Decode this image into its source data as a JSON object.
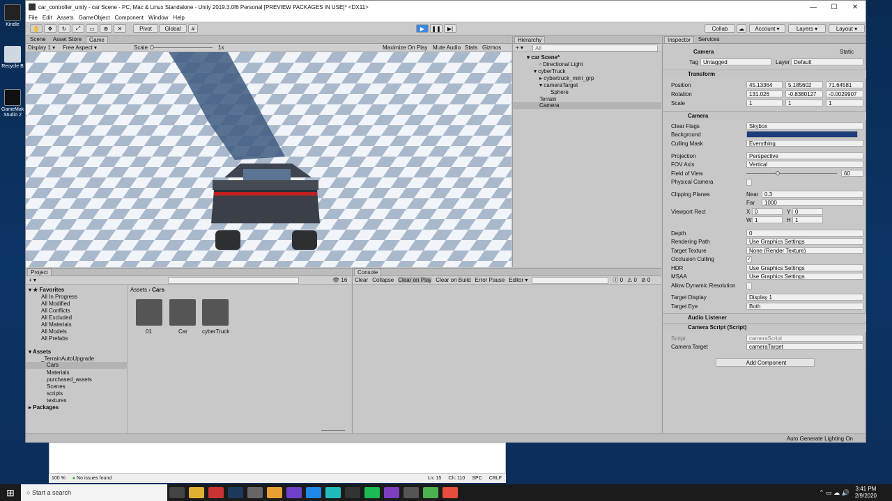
{
  "desktop": {
    "icons": [
      {
        "label": "Kindle"
      },
      {
        "label": "Recycle B"
      },
      {
        "label": "GameMak Studio 2"
      }
    ]
  },
  "vs": {
    "zoom": "100 %",
    "issues": "No issues found",
    "ln": "Ln: 15",
    "ch": "Ch: 110",
    "spc": "SPC",
    "crlf": "CRLF"
  },
  "window": {
    "title": "car_controller_unity - car Scene - PC, Mac & Linux Standalone - Unity 2019.3.0f6 Personal [PREVIEW PACKAGES IN USE]* <DX11>"
  },
  "menu": [
    "File",
    "Edit",
    "Assets",
    "GameObject",
    "Component",
    "Window",
    "Help"
  ],
  "toolbar": {
    "pivot": "Pivot",
    "global": "Global",
    "collab": "Collab",
    "account": "Account",
    "layers": "Layers",
    "layout": "Layout"
  },
  "game": {
    "tabs": [
      "Scene",
      "Asset Store",
      "Game"
    ],
    "display": "Display 1",
    "aspect": "Free Aspect",
    "scale_label": "Scale",
    "scale_value": "1x",
    "maximize": "Maximize On Play",
    "mute": "Mute Audio",
    "stats": "Stats",
    "gizmos": "Gizmos"
  },
  "hierarchy": {
    "title": "Hierarchy",
    "search": "All",
    "scene": "car Scene*",
    "items": [
      "Directional Light",
      "cyberTruck",
      "cybertruck_mini_grp",
      "cameraTarget",
      "Sphere",
      "Terrain",
      "Camera"
    ]
  },
  "project": {
    "title": "Project",
    "count": "16",
    "favorites_label": "Favorites",
    "favorites": [
      "All In Progress",
      "All Modified",
      "All Conflicts",
      "All Excluded",
      "All Materials",
      "All Models",
      "All Prefabs"
    ],
    "assets_label": "Assets",
    "assets": [
      "_TerrainAutoUpgrade",
      "Cars",
      "Materials",
      "purchased_assets",
      "Scenes",
      "scripts",
      "textures"
    ],
    "packages": "Packages",
    "breadcrumb": [
      "Assets",
      "Cars"
    ],
    "thumbs": [
      "01",
      "Car",
      "cyberTruck"
    ]
  },
  "console": {
    "title": "Console",
    "buttons": [
      "Clear",
      "Collapse",
      "Clear on Play",
      "Clear on Build",
      "Error Pause",
      "Editor"
    ],
    "counts": [
      "0",
      "0",
      "0"
    ]
  },
  "inspector": {
    "tabs": [
      "Inspector",
      "Services"
    ],
    "object_name": "Camera",
    "static": "Static",
    "tag_label": "Tag",
    "tag": "Untagged",
    "layer_label": "Layer",
    "layer": "Default",
    "transform": {
      "title": "Transform",
      "position": {
        "label": "Position",
        "x": "45.13364",
        "y": "5.185602",
        "z": "71.64581"
      },
      "rotation": {
        "label": "Rotation",
        "x": "131.026",
        "y": "-0.8380127",
        "z": "-0.0029907"
      },
      "scale": {
        "label": "Scale",
        "x": "1",
        "y": "1",
        "z": "1"
      }
    },
    "camera": {
      "title": "Camera",
      "clear_flags": [
        "Clear Flags",
        "Skybox"
      ],
      "background": "Background",
      "background_color": "#1d3d7a",
      "culling": [
        "Culling Mask",
        "Everything"
      ],
      "projection": [
        "Projection",
        "Perspective"
      ],
      "fov_axis": [
        "FOV Axis",
        "Vertical"
      ],
      "fov": [
        "Field of View",
        "60"
      ],
      "physical": "Physical Camera",
      "clipping": "Clipping Planes",
      "near": [
        "Near",
        "0.3"
      ],
      "far": [
        "Far",
        "1000"
      ],
      "viewport": "Viewport Rect",
      "vx": "0",
      "vy": "0",
      "vw": "1",
      "vh": "1",
      "depth": [
        "Depth",
        "0"
      ],
      "rendering": [
        "Rendering Path",
        "Use Graphics Settings"
      ],
      "target_texture": [
        "Target Texture",
        "None (Render Texture)"
      ],
      "occlusion": "Occlusion Culling",
      "hdr": [
        "HDR",
        "Use Graphics Settings"
      ],
      "msaa": [
        "MSAA",
        "Use Graphics Settings"
      ],
      "dynres": "Allow Dynamic Resolution",
      "target_display": [
        "Target Display",
        "Display 1"
      ],
      "target_eye": [
        "Target Eye",
        "Both"
      ]
    },
    "audio": "Audio Listener",
    "script": {
      "title": "Camera Script (Script)",
      "script_label": "Script",
      "script_value": "cameraScript",
      "target_label": "Camera Target",
      "target_value": "cameraTarget"
    },
    "add_component": "Add Component"
  },
  "status": "Auto Generate Lighting On",
  "taskbar": {
    "search": "Start a search",
    "time": "3:41 PM",
    "date": "2/9/2020"
  }
}
